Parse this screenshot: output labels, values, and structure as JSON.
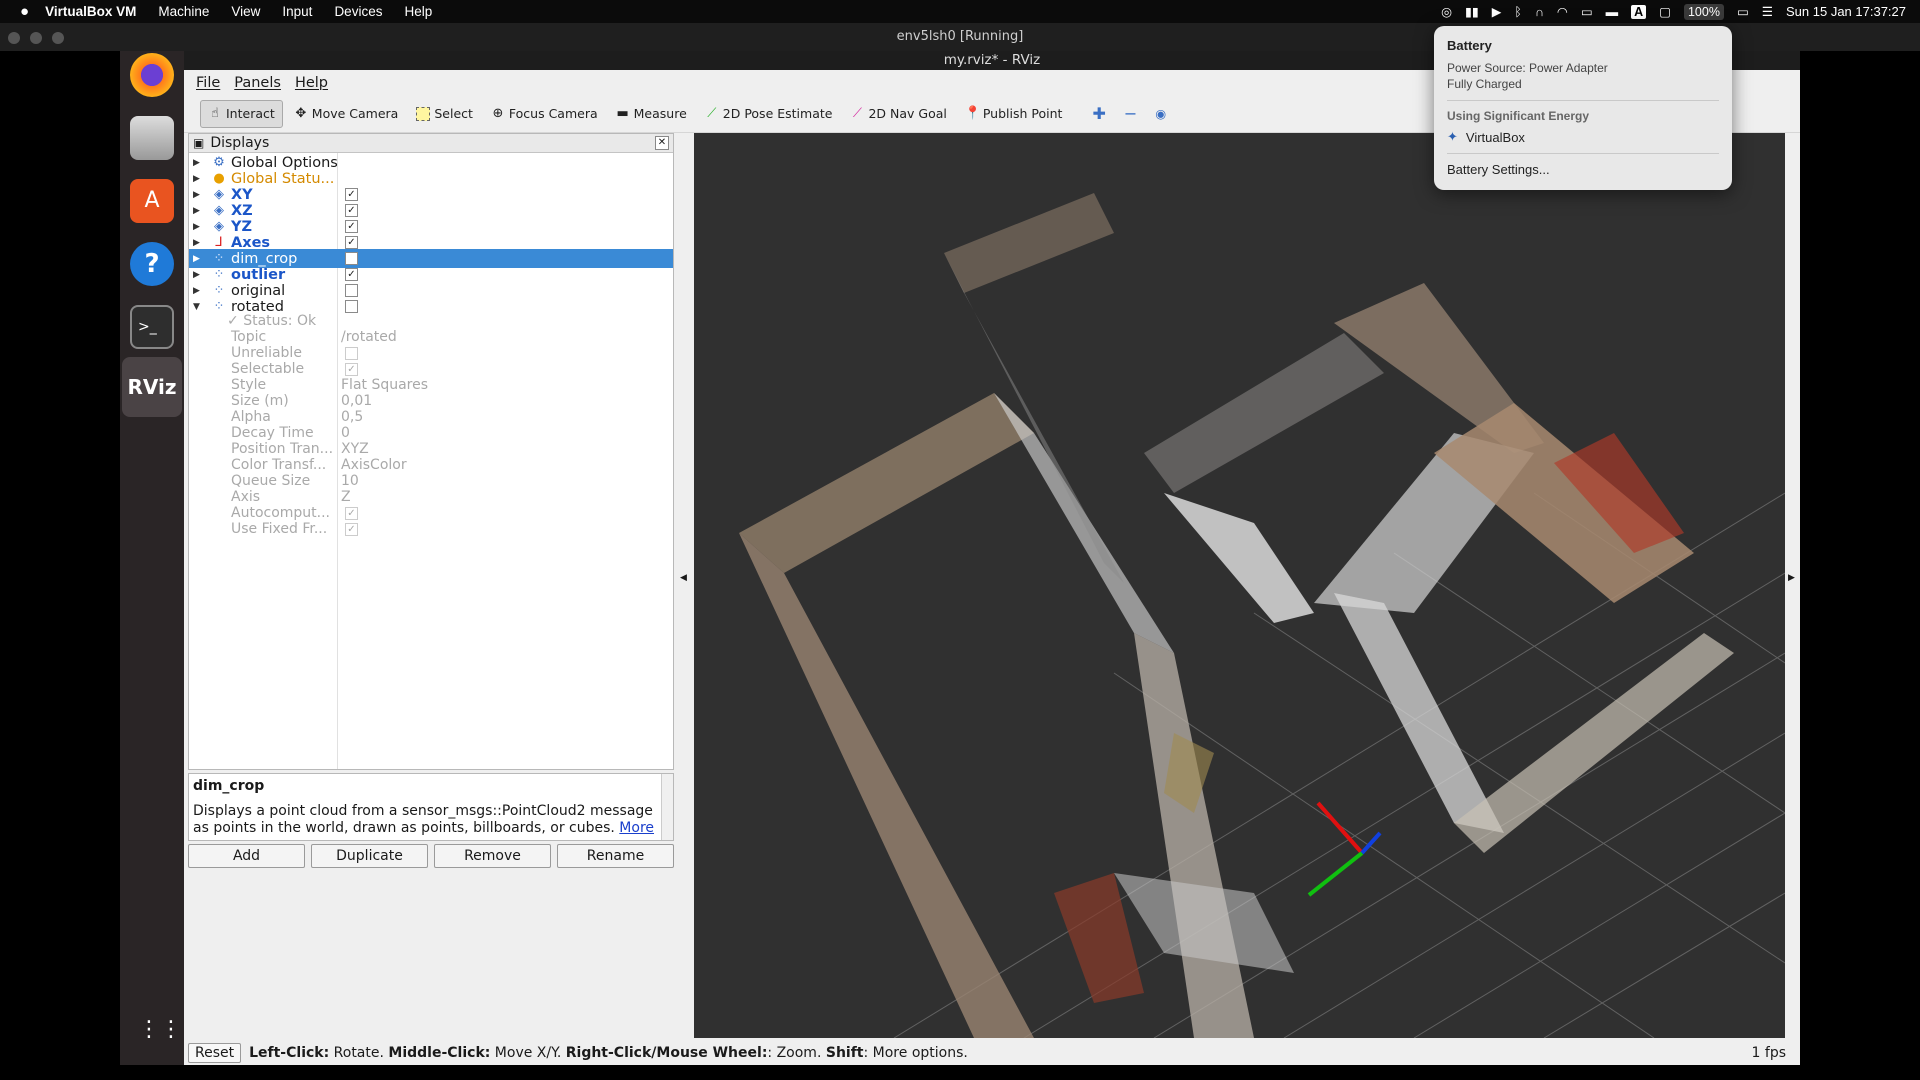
{
  "mac_menubar": {
    "app": "VirtualBox VM",
    "menus": [
      "Machine",
      "View",
      "Input",
      "Devices",
      "Help"
    ],
    "battery_pct": "100%",
    "datetime": "Sun 15 Jan  17:37:27",
    "input_badge": "A"
  },
  "vbox_window": {
    "title": "env5lsh0 [Running]"
  },
  "guest_window": {
    "title": "my.rviz* - RViz"
  },
  "rviz_menu": {
    "file": "File",
    "panels": "Panels",
    "help": "Help"
  },
  "toolbar": {
    "interact": "Interact",
    "move_camera": "Move Camera",
    "select": "Select",
    "focus_camera": "Focus Camera",
    "measure": "Measure",
    "pose_estimate": "2D Pose Estimate",
    "nav_goal": "2D Nav Goal",
    "publish_point": "Publish Point"
  },
  "displays": {
    "title": "Displays",
    "items": [
      {
        "label": "Global Options",
        "checked": null
      },
      {
        "label": "Global Statu...",
        "checked": null
      },
      {
        "label": "XY",
        "checked": true
      },
      {
        "label": "XZ",
        "checked": true
      },
      {
        "label": "YZ",
        "checked": true
      },
      {
        "label": "Axes",
        "checked": true
      },
      {
        "label": "dim_crop",
        "checked": false
      },
      {
        "label": "outlier",
        "checked": true
      },
      {
        "label": "original",
        "checked": false
      },
      {
        "label": "rotated",
        "checked": false
      }
    ],
    "status": "Status: Ok",
    "properties": [
      {
        "name": "Topic",
        "value": "/rotated"
      },
      {
        "name": "Unreliable",
        "value": ""
      },
      {
        "name": "Selectable",
        "value": ""
      },
      {
        "name": "Style",
        "value": "Flat Squares"
      },
      {
        "name": "Size (m)",
        "value": "0,01"
      },
      {
        "name": "Alpha",
        "value": "0,5"
      },
      {
        "name": "Decay Time",
        "value": "0"
      },
      {
        "name": "Position Tran...",
        "value": "XYZ"
      },
      {
        "name": "Color Transf...",
        "value": "AxisColor"
      },
      {
        "name": "Queue Size",
        "value": "10"
      },
      {
        "name": "Axis",
        "value": "Z"
      },
      {
        "name": "Autocomput...",
        "value": ""
      },
      {
        "name": "Use Fixed Fr...",
        "value": ""
      }
    ]
  },
  "description": {
    "title": "dim_crop",
    "text": "Displays a point cloud from a sensor_msgs::PointCloud2 message as points in the world, drawn as points, billboards, or cubes.",
    "link": "More"
  },
  "buttons": {
    "add": "Add",
    "duplicate": "Duplicate",
    "remove": "Remove",
    "rename": "Rename"
  },
  "statusbar": {
    "reset": "Reset",
    "left_click": "Left-Click:",
    "rotate": " Rotate. ",
    "middle_click": "Middle-Click:",
    "move": " Move X/Y. ",
    "right_click": "Right-Click/Mouse Wheel:",
    "zoom": ": Zoom. ",
    "shift": "Shift",
    "more": ": More options.",
    "fps": "1 fps"
  },
  "battery_popup": {
    "title": "Battery",
    "source": "Power Source: Power Adapter",
    "state": "Fully Charged",
    "energy_header": "Using Significant Energy",
    "energy_app": "VirtualBox",
    "settings": "Battery Settings..."
  }
}
